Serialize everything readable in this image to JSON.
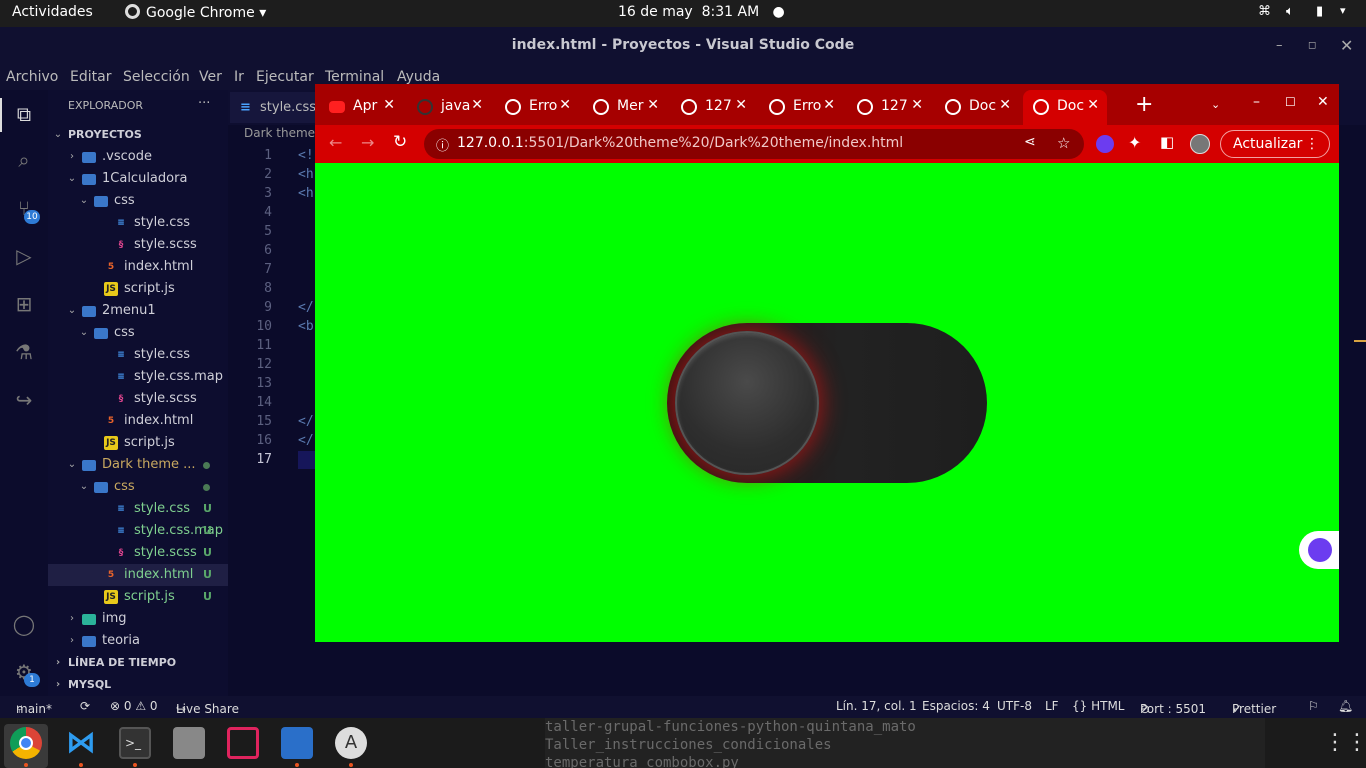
{
  "topbar": {
    "activities": "Actividades",
    "app_name": "Google Chrome",
    "date": "16 de may",
    "time": "8:31 AM"
  },
  "vscode": {
    "title": "index.html - Proyectos - Visual Studio Code",
    "menu": [
      "Archivo",
      "Editar",
      "Selección",
      "Ver",
      "Ir",
      "Ejecutar",
      "Terminal",
      "Ayuda"
    ],
    "explorer_label": "EXPLORADOR",
    "explorer_more": "···",
    "badges": {
      "source_control": "10",
      "settings": "1"
    },
    "tree": [
      {
        "label": "PROYECTOS",
        "depth": 0,
        "kind": "section",
        "open": true
      },
      {
        "label": ".vscode",
        "depth": 1,
        "kind": "folder",
        "open": false
      },
      {
        "label": "1Calculadora",
        "depth": 1,
        "kind": "folder",
        "open": true
      },
      {
        "label": "css",
        "depth": 2,
        "kind": "folder",
        "open": true
      },
      {
        "label": "style.css",
        "depth": 3,
        "kind": "css"
      },
      {
        "label": "style.scss",
        "depth": 3,
        "kind": "scss"
      },
      {
        "label": "index.html",
        "depth": 2,
        "kind": "html"
      },
      {
        "label": "script.js",
        "depth": 2,
        "kind": "js"
      },
      {
        "label": "2menu1",
        "depth": 1,
        "kind": "folder",
        "open": true
      },
      {
        "label": "css",
        "depth": 2,
        "kind": "folder",
        "open": true
      },
      {
        "label": "style.css",
        "depth": 3,
        "kind": "css"
      },
      {
        "label": "style.css.map",
        "depth": 3,
        "kind": "css"
      },
      {
        "label": "style.scss",
        "depth": 3,
        "kind": "scss"
      },
      {
        "label": "index.html",
        "depth": 2,
        "kind": "html"
      },
      {
        "label": "script.js",
        "depth": 2,
        "kind": "js"
      },
      {
        "label": "Dark theme ...",
        "depth": 1,
        "kind": "folder",
        "open": true,
        "modified": true
      },
      {
        "label": "css",
        "depth": 2,
        "kind": "folder",
        "open": true,
        "modified": true
      },
      {
        "label": "style.css",
        "depth": 3,
        "kind": "css",
        "status": "U"
      },
      {
        "label": "style.css.map",
        "depth": 3,
        "kind": "css",
        "status": "U"
      },
      {
        "label": "style.scss",
        "depth": 3,
        "kind": "scss",
        "status": "U"
      },
      {
        "label": "index.html",
        "depth": 2,
        "kind": "html",
        "status": "U",
        "selected": true
      },
      {
        "label": "script.js",
        "depth": 2,
        "kind": "js",
        "status": "U"
      },
      {
        "label": "img",
        "depth": 1,
        "kind": "imgfolder",
        "open": false
      },
      {
        "label": "teoria",
        "depth": 1,
        "kind": "folder",
        "open": false
      }
    ],
    "bottom_sections": [
      "LÍNEA DE TIEMPO",
      "MYSQL"
    ],
    "editor_tab": "style.css",
    "breadcrumb": "Dark theme",
    "line_numbers": [
      "1",
      "2",
      "3",
      "4",
      "5",
      "6",
      "7",
      "8",
      "9",
      "10",
      "11",
      "12",
      "13",
      "14",
      "15",
      "16",
      "17"
    ],
    "code_fragments": [
      "<!",
      "<h",
      "<h",
      "",
      "",
      "",
      "",
      "",
      "</",
      "<b",
      "",
      "",
      "",
      "",
      "</",
      "</",
      ""
    ],
    "status": {
      "branch": "main*",
      "problems": "⊗ 0 ⚠ 0",
      "live_share": "Live Share",
      "position": "Lín. 17, col. 1",
      "spaces": "Espacios: 4",
      "encoding": "UTF-8",
      "eol": "LF",
      "language": "{} HTML",
      "port": "Port : 5501",
      "prettier": "Prettier"
    }
  },
  "chrome": {
    "tabs": [
      {
        "title": "Apr",
        "icon": "youtube-icon"
      },
      {
        "title": "java",
        "icon": "github-icon"
      },
      {
        "title": "Erro",
        "icon": "globe-icon"
      },
      {
        "title": "Mer",
        "icon": "globe-icon"
      },
      {
        "title": "127",
        "icon": "globe-icon"
      },
      {
        "title": "Erro",
        "icon": "globe-icon"
      },
      {
        "title": "127",
        "icon": "globe-icon"
      },
      {
        "title": "Doc",
        "icon": "globe-icon"
      },
      {
        "title": "Doc",
        "icon": "globe-icon",
        "active": true
      }
    ],
    "url_host": "127.0.0.1",
    "url_rest": ":5501/Dark%20theme%20/Dark%20theme/index.html",
    "update_button": "Actualizar",
    "page_background": "#00ff00"
  },
  "taskbar": {
    "terminal_lines": [
      "taller-grupal-funciones-python-quintana_mato",
      "Taller_instrucciones_condicionales",
      "temperatura_combobox.py"
    ]
  },
  "colors": {
    "chrome_frame": "#a60000",
    "chrome_active": "#d40000",
    "vscode_bg": "#0b0b2a",
    "accent_blue": "#2e7bd6"
  }
}
